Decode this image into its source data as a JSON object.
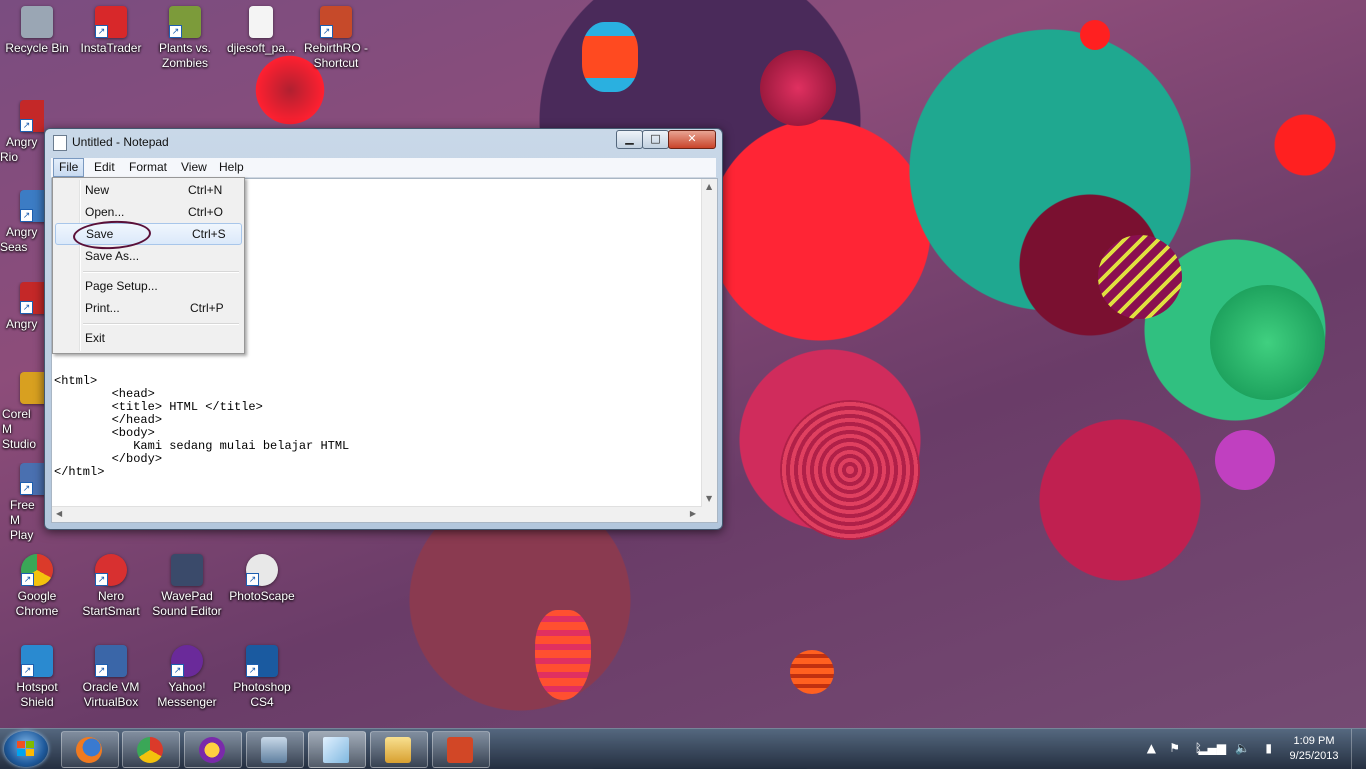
{
  "desktop_icons": [
    {
      "label": "Recycle Bin",
      "color": "#9aa6b4"
    },
    {
      "label": "InstaTrader",
      "color": "#d8282a"
    },
    {
      "label": "Plants vs. Zombies",
      "color": "#7c9b3a"
    },
    {
      "label": "djiesoft_pa...",
      "color": "#f4f4f4"
    },
    {
      "label": "RebirthRO - Shortcut",
      "color": "#c64a2a"
    },
    {
      "label": "Angry Rio",
      "color": "#c42828"
    },
    {
      "label": "Angry Seas",
      "color": "#3c7cc4"
    },
    {
      "label": "Angry",
      "color": "#c42828"
    },
    {
      "label": "Corel M Studio",
      "color": "#d8a020"
    },
    {
      "label": "Free M Play",
      "color": "#4a70b0"
    },
    {
      "label": "Google Chrome",
      "color": "#e8b020"
    },
    {
      "label": "Nero StartSmart",
      "color": "#d83030"
    },
    {
      "label": "WavePad Sound Editor",
      "color": "#3a4a6a"
    },
    {
      "label": "PhotoScape",
      "color": "#e8e8e8"
    },
    {
      "label": "Hotspot Shield",
      "color": "#2a8ad0"
    },
    {
      "label": "Oracle VM VirtualBox",
      "color": "#3a66a8"
    },
    {
      "label": "Yahoo! Messenger",
      "color": "#6a2a9a"
    },
    {
      "label": "Photoshop CS4",
      "color": "#1a5aa0"
    }
  ],
  "notepad": {
    "title": "Untitled - Notepad",
    "menu": [
      "File",
      "Edit",
      "Format",
      "View",
      "Help"
    ],
    "content": "<html>\n        <head>\n        <title> HTML </title>\n        </head>\n        <body>\n           Kami sedang mulai belajar HTML\n        </body>\n</html>"
  },
  "file_menu": [
    {
      "label": "New",
      "shortcut": "Ctrl+N"
    },
    {
      "label": "Open...",
      "shortcut": "Ctrl+O"
    },
    {
      "label": "Save",
      "shortcut": "Ctrl+S"
    },
    {
      "label": "Save As...",
      "shortcut": ""
    },
    {
      "label": "Page Setup...",
      "shortcut": ""
    },
    {
      "label": "Print...",
      "shortcut": "Ctrl+P"
    },
    {
      "label": "Exit",
      "shortcut": ""
    }
  ],
  "taskbar": {
    "pinned": [
      "firefox-icon",
      "chrome-icon",
      "yahoo-messenger-icon",
      "remote-desktop-icon",
      "notepad-icon",
      "explorer-icon",
      "powerpoint-icon"
    ],
    "clock_time": "1:09 PM",
    "clock_date": "9/25/2013"
  },
  "colors": {
    "highlight": "#dbe9fa",
    "annotation_circle": "#5a1038"
  }
}
